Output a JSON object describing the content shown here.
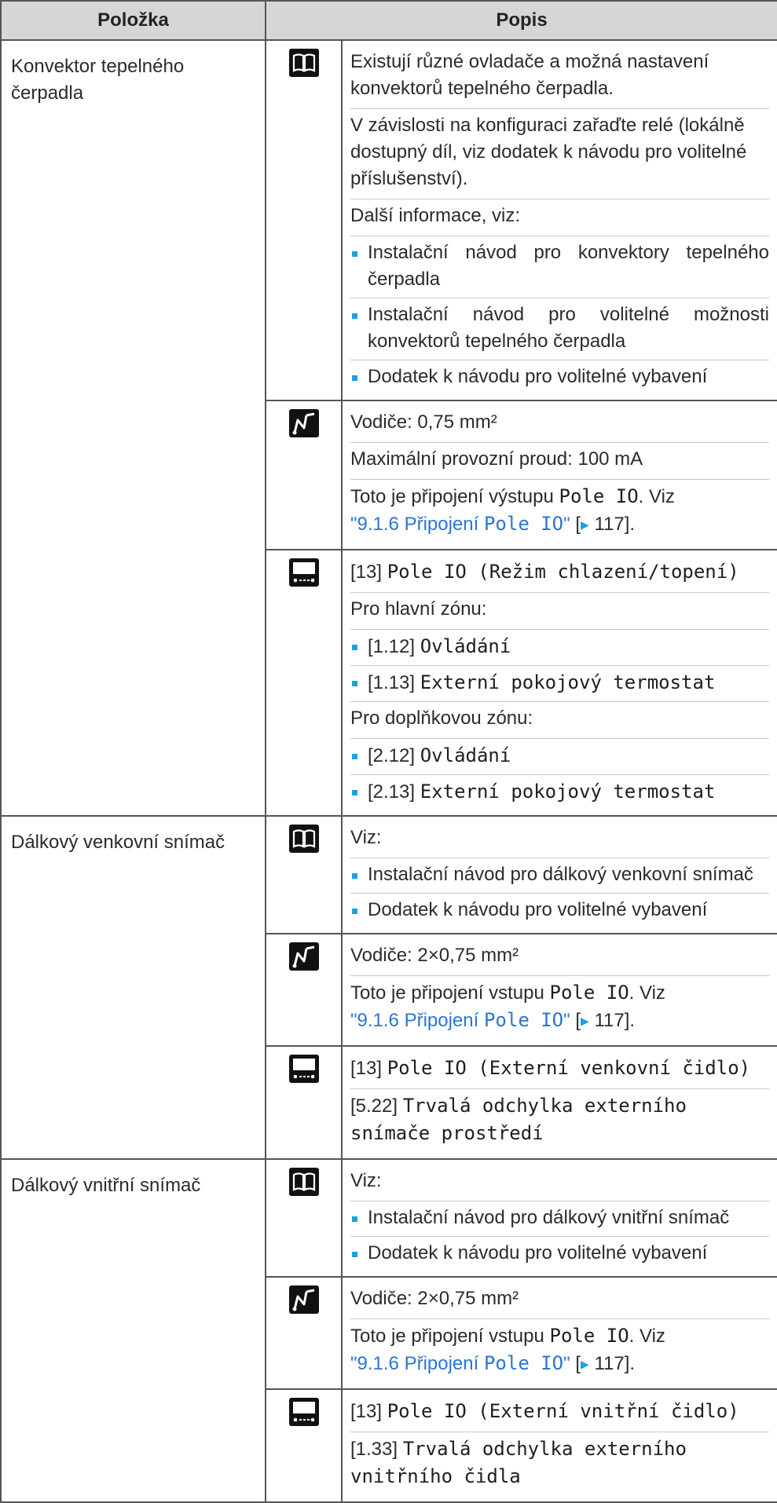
{
  "header": {
    "col1": "Položka",
    "col2": "Popis"
  },
  "rows": [
    {
      "item": "Konvektor tepelného čerpadla",
      "book": {
        "p1": "Existují různé ovladače a možná nastavení konvektorů tepelného čerpadla.",
        "p2": "V závislosti na konfiguraci zařaďte relé (lokálně dostupný díl, viz dodatek k návodu pro volitelné příslušenství).",
        "p3": "Další informace, viz:",
        "b1": "Instalační návod pro konvektory tepelného čerpadla",
        "b2": "Instalační návod pro volitelné možnosti konvektorů tepelného čerpadla",
        "b3": "Dodatek k návodu pro volitelné vybavení"
      },
      "wire": {
        "p1": "Vodiče: 0,75 mm²",
        "p2": "Maximální provozní proud: 100 mA",
        "p3_pre": "Toto je připojení výstupu ",
        "p3_code": "Pole IO",
        "p3_post": ". Viz ",
        "link_pre": "\"9.1.6 Připojení ",
        "link_code": "Pole IO",
        "link_post": "\"",
        "ref_open": " [",
        "ref_arrow": "▶",
        "ref_page": " 117",
        "ref_close": "]."
      },
      "ui": {
        "l1_num": "[13] ",
        "l1_code": "Pole IO",
        "l1_paren": " (Režim chlazení/topení)",
        "l2": "Pro hlavní zónu:",
        "b1_num": "[1.12] ",
        "b1_code": "Ovládání",
        "b2_num": "[1.13] ",
        "b2_code": "Externí pokojový termostat",
        "l3": "Pro doplňkovou zónu:",
        "b3_num": "[2.12] ",
        "b3_code": "Ovládání",
        "b4_num": "[2.13] ",
        "b4_code": "Externí pokojový termostat"
      }
    },
    {
      "item": "Dálkový venkovní snímač",
      "book": {
        "p1": "Viz:",
        "b1": "Instalační návod pro dálkový venkovní snímač",
        "b2": "Dodatek k návodu pro volitelné vybavení"
      },
      "wire": {
        "p1": "Vodiče: 2×0,75 mm²",
        "p2_pre": "Toto je připojení vstupu ",
        "p2_code": "Pole IO",
        "p2_post": ". Viz ",
        "link_pre": "\"9.1.6 Připojení ",
        "link_code": "Pole IO",
        "link_post": "\"",
        "ref_open": " [",
        "ref_arrow": "▶",
        "ref_page": " 117",
        "ref_close": "]."
      },
      "ui": {
        "l1_num": "[13] ",
        "l1_code": "Pole IO",
        "l1_paren": " (Externí venkovní čidlo)",
        "l2_num": "[5.22] ",
        "l2_code": "Trvalá odchylka externího snímače prostředí"
      }
    },
    {
      "item": "Dálkový vnitřní snímač",
      "book": {
        "p1": "Viz:",
        "b1": "Instalační návod pro dálkový vnitřní snímač",
        "b2": "Dodatek k návodu pro volitelné vybavení"
      },
      "wire": {
        "p1": "Vodiče: 2×0,75 mm²",
        "p2_pre": "Toto je připojení vstupu ",
        "p2_code": "Pole IO",
        "p2_post": ". Viz ",
        "link_pre": "\"9.1.6 Připojení ",
        "link_code": "Pole IO",
        "link_post": "\"",
        "ref_open": " [",
        "ref_arrow": "▶",
        "ref_page": " 117",
        "ref_close": "]."
      },
      "ui": {
        "l1_num": "[13] ",
        "l1_code": "Pole IO",
        "l1_paren": " (Externí vnitřní čidlo)",
        "l2_num": "[1.33] ",
        "l2_code": "Trvalá odchylka externího vnitřního čidla"
      }
    }
  ],
  "icons": {
    "book": "book-icon",
    "wire": "wire-icon",
    "ui": "user-interface-icon"
  },
  "colors": {
    "header_bg": "#d6d6d6",
    "bullet": "#1aa3dc",
    "link": "#2a75d6",
    "border": "#555555"
  }
}
